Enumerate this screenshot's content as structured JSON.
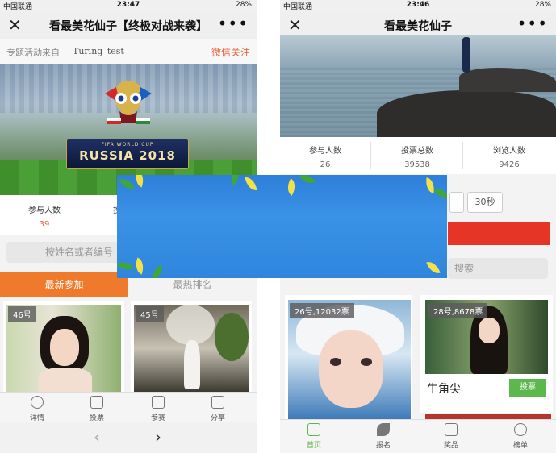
{
  "left": {
    "status": {
      "carrier": "中国联通",
      "time": "23:47",
      "battery": "28%"
    },
    "nav": {
      "close": "✕",
      "title": "看最美花仙子【终极对战来袭】",
      "more": "•••"
    },
    "source": {
      "label": "专题活动来自",
      "name": "Turing_test",
      "follow": "微信关注"
    },
    "banner": {
      "top_text": "FIFA WORLD CUP",
      "main_text": "RUSSIA 2018"
    },
    "stats": [
      {
        "label": "参与人数",
        "value": "39"
      },
      {
        "label": "投",
        "value": ""
      }
    ],
    "search_placeholder": "按姓名或者编号",
    "tabs": [
      {
        "label": "最新参加"
      },
      {
        "label": "最热排名"
      }
    ],
    "cards": [
      {
        "badge": "46号"
      },
      {
        "badge": "45号"
      }
    ],
    "bottom_nav": [
      {
        "label": "详情",
        "icon": "chat-icon"
      },
      {
        "label": "投票",
        "icon": "clipboard-icon"
      },
      {
        "label": "参赛",
        "icon": "layers-icon"
      },
      {
        "label": "分享",
        "icon": "edit-icon"
      }
    ],
    "pager": {
      "prev": "‹",
      "next": "›"
    }
  },
  "right": {
    "status": {
      "carrier": "中国联通",
      "time": "23:46",
      "battery": "28%"
    },
    "nav": {
      "close": "✕",
      "title": "看最美花仙子",
      "more": "•••"
    },
    "stats": [
      {
        "label": "参与人数",
        "value": "26"
      },
      {
        "label": "投票总数",
        "value": "39538"
      },
      {
        "label": "浏览人数",
        "value": "9426"
      }
    ],
    "timer": "30秒",
    "search_placeholder": "搜索",
    "cards": [
      {
        "badge": "26号,12032票",
        "name": ""
      },
      {
        "badge": "28号,8678票",
        "name": "牛角尖",
        "vote": "投票"
      }
    ],
    "bottom_nav": [
      {
        "label": "首页",
        "icon": "home-icon"
      },
      {
        "label": "报名",
        "icon": "feather-icon"
      },
      {
        "label": "奖品",
        "icon": "gift-icon"
      },
      {
        "label": "榜单",
        "icon": "medal-icon"
      }
    ]
  },
  "colors": {
    "accent_orange": "#ef7a2c",
    "follow_red": "#e4603c",
    "vote_green": "#5cb84c",
    "red_bar": "#e43527",
    "overlay_blue": "#3a92e6"
  }
}
